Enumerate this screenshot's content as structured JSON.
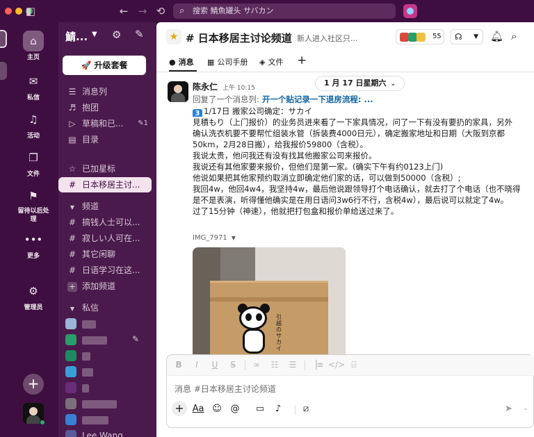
{
  "titlebar": {
    "search_placeholder": "搜索 鯖魚罐头 サバカン"
  },
  "rail": {
    "items": [
      {
        "label": "主页",
        "icon": "home-icon"
      },
      {
        "label": "私信",
        "icon": "dm-icon"
      },
      {
        "label": "活动",
        "icon": "bell-icon"
      },
      {
        "label": "文件",
        "icon": "files-icon"
      },
      {
        "label": "留待以后处理",
        "icon": "bookmark-icon"
      },
      {
        "label": "更多",
        "icon": "more-icon"
      },
      {
        "label": "管理员",
        "icon": "gear-icon"
      }
    ]
  },
  "sidebar": {
    "workspace_name": "鯖...",
    "upgrade_label": "升级套餐",
    "nav": [
      {
        "label": "消息列",
        "icon": "threads-icon"
      },
      {
        "label": "抱团",
        "icon": "headphones-icon"
      },
      {
        "label": "草稿和已...",
        "icon": "send-icon",
        "badge": "1"
      },
      {
        "label": "目录",
        "icon": "directory-icon"
      }
    ],
    "starred_label": "已加星标",
    "active_channel": "日本移居主讨...",
    "channels_section": "频道",
    "channels": [
      "搞钱人士可以...",
      "寂しい人可在...",
      "其它闲聊",
      "日语学习在这..."
    ],
    "add_channel": "添加频道",
    "dm_section": "私信",
    "last_dm": "Lee Wang"
  },
  "channel": {
    "name": "# 日本移居主讨论频道",
    "description": "新人进入社区只...",
    "member_count": "55",
    "tabs": [
      "消息",
      "公司手册",
      "文件"
    ]
  },
  "date_divider": "1 月 17 日星期六",
  "message": {
    "author": "陈永仁",
    "time": "上午 10:15",
    "reply_prefix": "回复了一个消息列:",
    "reply_link": "开一个贴记录一下退房流程: ...",
    "lines": [
      "1/17日 搬家公司确定：サカイ",
      "見積もり（上门报价）的业务员进来看了一下家具情况，问了一下有没有要扔的家具，另外",
      "确认洗衣机要不要帮忙组装水管（拆装费4000日元），确定搬家地址和日期（大阪到京都",
      "50km，2月28日搬），给我报价59800（含税）。",
      "我说太贵，他问我还有没有找其他搬家公司来报价。",
      "我说还有其他家要来报价，但他们是第一家。(确实下午有约0123上门)",
      "他说如果把其他家预约取消立即确定他们家的话，可以做到50000（含税）;",
      "我回4w，他回4w4，我坚持4w，最后他说跟领导打个电话确认，就去打了个电话（也不晓得",
      "是不是表演，听得懂他确实是在用日语问3w6行不行，含税4w），最后说可以就定了4w。",
      "过了15分钟（神速），他就把打包盒和报价单给送过来了。"
    ],
    "number_badge": "3",
    "attachment_name": "IMG_7971",
    "box_text": "引越のサカイ"
  },
  "composer": {
    "placeholder": "消息 #日本移居主讨论频道"
  },
  "colors": {
    "aubergine": "#3f0e40",
    "sidebar": "#4b1a4c",
    "link": "#1264a3",
    "presence": "#2bac76"
  }
}
